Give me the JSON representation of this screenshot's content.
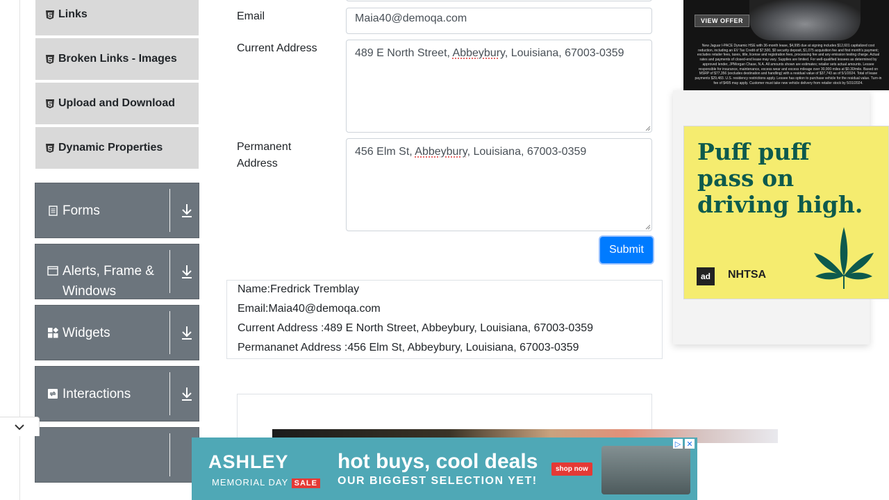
{
  "sidebar": {
    "subitems": [
      {
        "label": "Links"
      },
      {
        "label": "Broken Links - Images"
      },
      {
        "label": "Upload and Download"
      },
      {
        "label": "Dynamic Properties"
      }
    ],
    "groups": [
      {
        "label": "Forms",
        "icon": "form-icon"
      },
      {
        "label": "Alerts, Frame & Windows",
        "icon": "window-icon"
      },
      {
        "label": "Widgets",
        "icon": "widgets-icon"
      },
      {
        "label": "Interactions",
        "icon": "interactions-icon"
      }
    ]
  },
  "form": {
    "email_label": "Email",
    "email_value": "Maia40@demoqa.com",
    "current_address_label": "Current Address",
    "current_address_parts": [
      "489 E North Street, ",
      "Abbeybury",
      ", Louisiana, 67003-0359"
    ],
    "permanent_address_label_line1": "Permanent",
    "permanent_address_label_line2": "Address",
    "permanent_address_parts": [
      "456 Elm St, ",
      "Abbeybury",
      ", Louisiana, 67003-0359"
    ],
    "submit_label": "Submit"
  },
  "output": {
    "name": "Name:Fredrick Tremblay",
    "email": "Email:Maia40@demoqa.com",
    "current_address": "Current Address :489 E North Street, Abbeybury, Louisiana, 67003-0359",
    "permanent_address": "Permananet Address :456 Elm St, Abbeybury, Louisiana, 67003-0359"
  },
  "ads": {
    "top_offer": "VIEW OFFER",
    "top_fine_print": "New Jaguar I-PACE Dynamic HSE with 36-month lease, $4,995 due at signing includes $12,601 capitalized cost reduction, including an EV Tax Credit of $7,500, $0 security deposit, $1,075 acquisition fee and first month's payment; excludes retailer fees, taxes, title, license and registration fees, processing fee and any emission testing charge. Actual rates and payments of closed-end lease may vary. Supplies are limited. For well-qualified lessees as determined by approved lender, JPMorgan Chase, N.A. All amounts shown are estimates; retailer sets actual amounts. Lessee responsible for insurance, maintenance, excess wear and excess mileage over 30,000 miles at $0.30/mile. Based on MSRP of $77,356 (excludes destination and handling) with a residual value of $37,743 as of 5/1/2024. Total of lease payments $29,483. U.S. residency restrictions apply. Lessee has option to purchase vehicle for the residual value. Turn-in fee of $495 may apply. Customer must take new vehicle delivery from retailer stock by 5/31/2024.",
    "yellow_headline_1": "Puff puff",
    "yellow_headline_2": "pass on",
    "yellow_headline_3": "driving high.",
    "yellow_logo_1": "ad",
    "yellow_logo_2": "NHTSA",
    "bottom_brand": "ASHLEY",
    "bottom_sub": "MEMORIAL DAY",
    "bottom_sale": "SALE",
    "bottom_headline": "hot buys, cool deals",
    "bottom_sub2": "OUR BIGGEST SELECTION YET!",
    "bottom_shop": "shop now"
  }
}
